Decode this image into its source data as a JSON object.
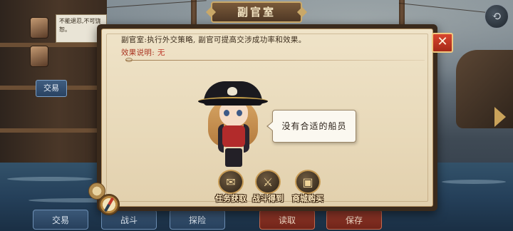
{
  "dialog": {
    "title": "副官室",
    "description": "副官室:执行外交策略, 副官可提高交涉成功率和效果。",
    "effect_label": "效果说明:",
    "effect_value": "无",
    "close_label": "✕",
    "speech": "没有合适的船员",
    "actions": [
      {
        "label": "任务获取",
        "icon": "quest-scroll-icon",
        "glyph": "✉"
      },
      {
        "label": "战斗得到",
        "icon": "battle-gate-icon",
        "glyph": "⚔"
      },
      {
        "label": "商城购买",
        "icon": "treasure-chest-icon",
        "glyph": "▣"
      }
    ]
  },
  "background": {
    "note_text": "不能退忍,不可饶恕。",
    "side_button": "交易",
    "tabs": [
      "交易",
      "战斗",
      "探险",
      "读取",
      "保存"
    ]
  },
  "colors": {
    "parchment": "#efe3c8",
    "close_red": "#d8452e",
    "effect_red": "#a8321f",
    "plaque_brown": "#7a5a3a"
  }
}
